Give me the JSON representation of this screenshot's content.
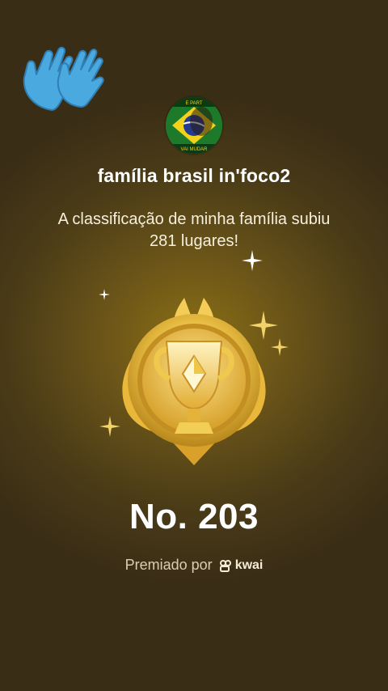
{
  "header": {
    "avatar_top_text": "E PART",
    "avatar_bottom_text": "VAI MUDAR"
  },
  "family_name": "família brasil in'foco2",
  "message": "A classificação de minha família subiu 281 lugares!",
  "rank": "No. 203",
  "award": {
    "prefix": "Premiado por",
    "brand": "kwai"
  },
  "icons": {
    "clap": "clapping-hands-icon",
    "trophy": "gold-trophy-badge-icon",
    "brand_logo": "kwai-logo-icon",
    "sparkle": "sparkle-icon"
  },
  "colors": {
    "gold": "#e9c04a",
    "clap_blue": "#4aa9df",
    "background": "#4a3b17"
  }
}
